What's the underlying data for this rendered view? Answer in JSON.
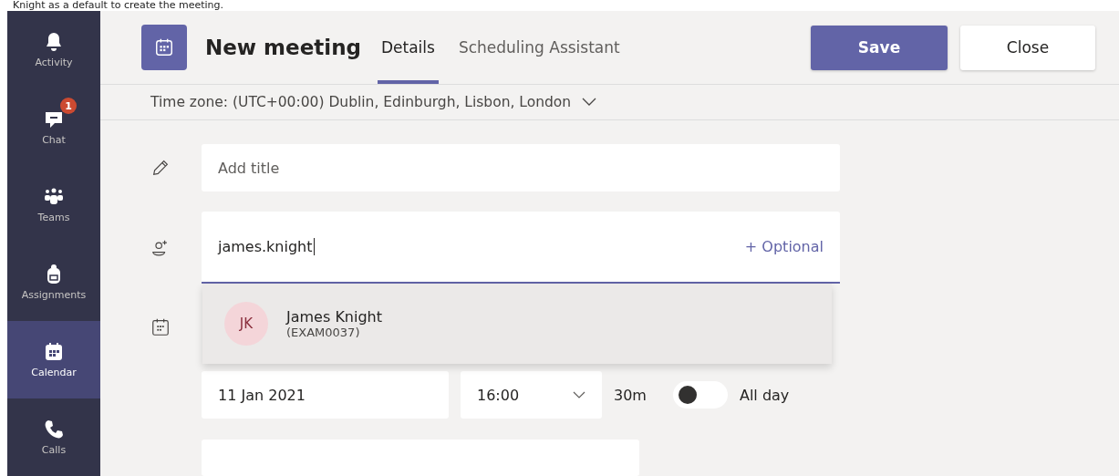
{
  "caption": "Knight as a default to create the meeting.",
  "sidebar": {
    "items": [
      {
        "label": "Activity",
        "selected": false
      },
      {
        "label": "Chat",
        "selected": false,
        "badge": "1"
      },
      {
        "label": "Teams",
        "selected": false
      },
      {
        "label": "Assignments",
        "selected": false
      },
      {
        "label": "Calendar",
        "selected": true
      },
      {
        "label": "Calls",
        "selected": false
      }
    ]
  },
  "header": {
    "title": "New meeting",
    "tabs": [
      {
        "label": "Details",
        "selected": true
      },
      {
        "label": "Scheduling Assistant",
        "selected": false
      }
    ],
    "buttons": [
      {
        "label": "Save",
        "kind": "primary"
      },
      {
        "label": "Close",
        "kind": "secondary"
      }
    ]
  },
  "time_zone": "Time zone: (UTC+00:00) Dublin, Edinburgh, Lisbon, London",
  "form": {
    "title_field": {
      "placeholder": "Add title"
    },
    "attendees": {
      "value": "james.knight",
      "optional_link": "+ Optional"
    },
    "suggestions": [
      {
        "initials": "JK",
        "name": "James Knight",
        "id": "(EXAM0037)"
      }
    ],
    "date": "11 Jan 2021",
    "time": "16:00",
    "duration": "30m",
    "all_day": {
      "label": "All day",
      "on": false
    }
  }
}
